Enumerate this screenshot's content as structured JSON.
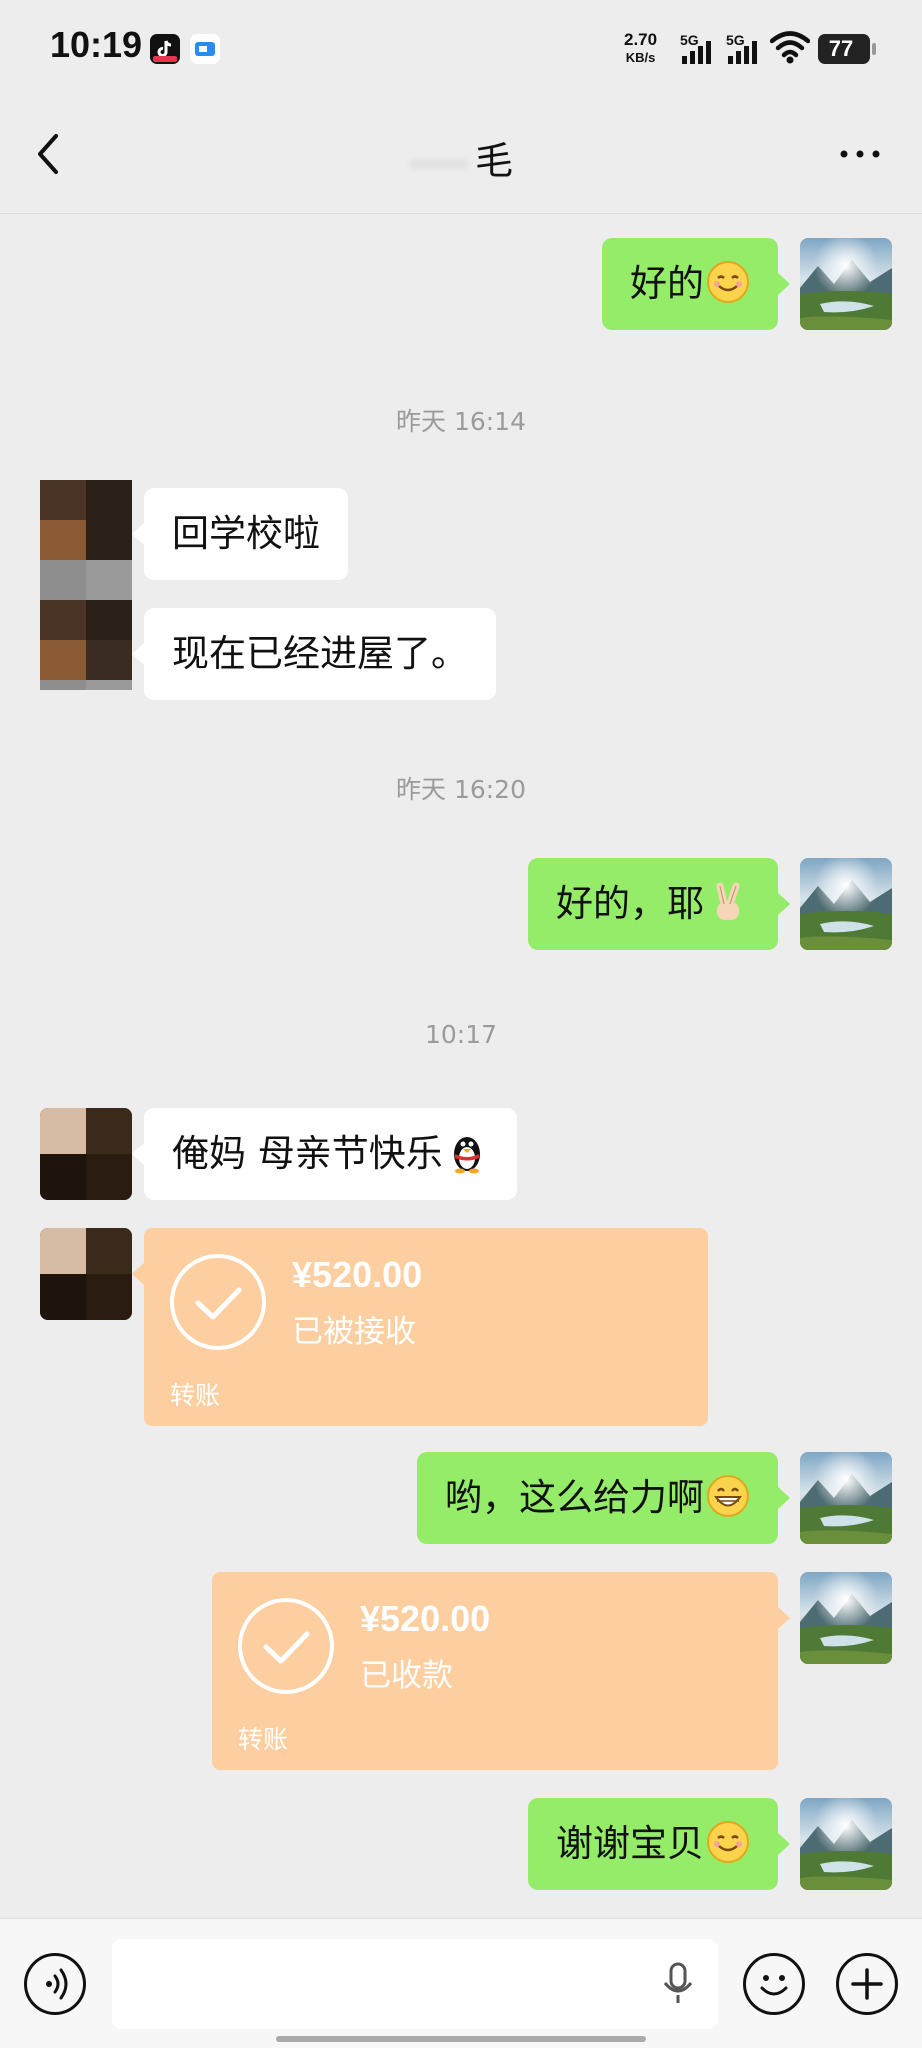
{
  "status_bar": {
    "time": "10:19",
    "net_speed": "2.70",
    "net_unit": "KB/s",
    "signal1": "5G",
    "signal2": "5G",
    "battery": "77"
  },
  "header": {
    "title": "毛"
  },
  "messages": [
    {
      "kind": "text",
      "side": "me",
      "text": "好的",
      "emoji": "smile"
    },
    {
      "kind": "time",
      "text": "昨天 16:14"
    },
    {
      "kind": "text",
      "side": "other",
      "text": "回学校啦"
    },
    {
      "kind": "text",
      "side": "other",
      "text": "现在已经进屋了。"
    },
    {
      "kind": "time",
      "text": "昨天 16:20"
    },
    {
      "kind": "text",
      "side": "me",
      "text": "好的，耶",
      "emoji": "victory-hand"
    },
    {
      "kind": "time",
      "text": "10:17"
    },
    {
      "kind": "text",
      "side": "other",
      "text": "俺妈 母亲节快乐",
      "emoji": "penguin"
    },
    {
      "kind": "transfer",
      "side": "other",
      "amount": "¥520.00",
      "status": "已被接收",
      "label": "转账"
    },
    {
      "kind": "text",
      "side": "me",
      "text": "哟，这么给力啊",
      "emoji": "grin"
    },
    {
      "kind": "transfer",
      "side": "me",
      "amount": "¥520.00",
      "status": "已收款",
      "label": "转账"
    },
    {
      "kind": "text",
      "side": "me",
      "text": "谢谢宝贝",
      "emoji": "smile"
    }
  ],
  "colors": {
    "my_bubble": "#95ec69",
    "other_bubble": "#ffffff",
    "transfer": "#fdcfa0",
    "background": "#ededed"
  }
}
